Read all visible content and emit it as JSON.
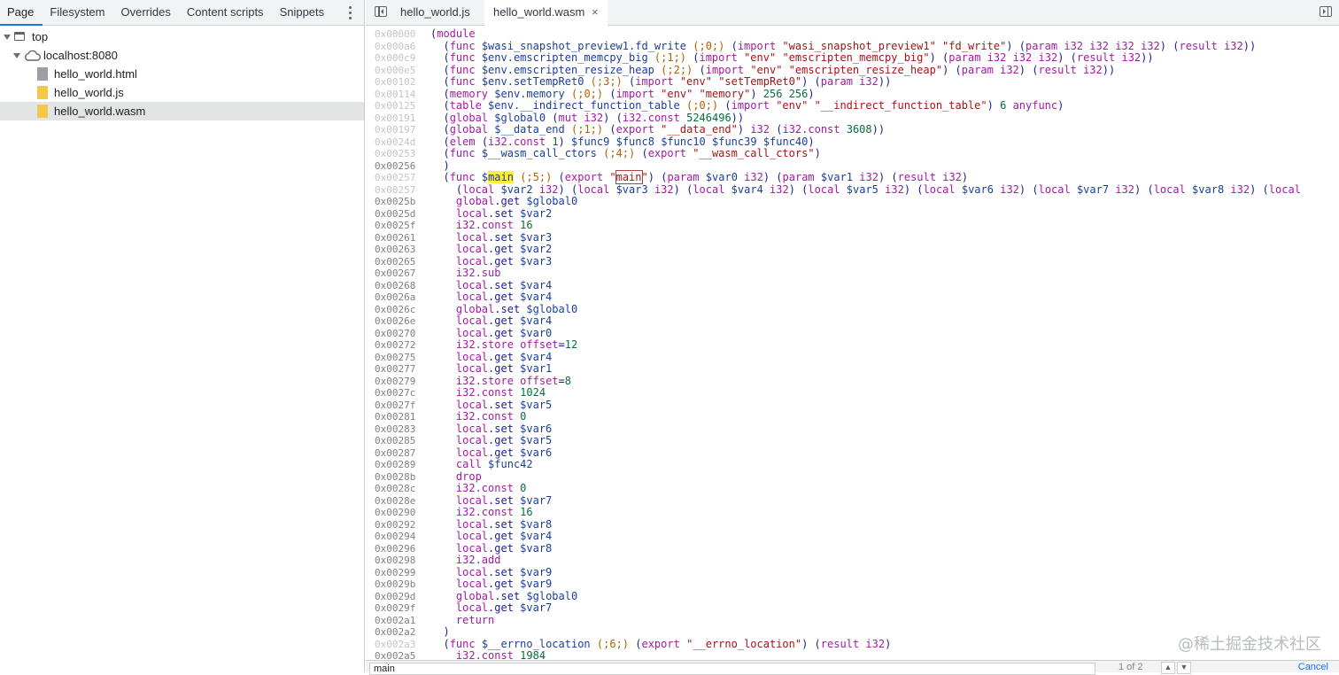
{
  "nav": {
    "tabs": [
      "Page",
      "Filesystem",
      "Overrides",
      "Content scripts",
      "Snippets"
    ],
    "active_tab": "Page",
    "more_icon": "more-vert-icon",
    "tree": [
      {
        "label": "top",
        "icon": "frame-icon"
      },
      {
        "label": "localhost:8080",
        "icon": "cloud-icon"
      },
      {
        "label": "hello_world.html",
        "icon": "file-icon"
      },
      {
        "label": "hello_world.js",
        "icon": "file-icon"
      },
      {
        "label": "hello_world.wasm",
        "icon": "file-icon",
        "selected": true
      }
    ]
  },
  "editor": {
    "tabs": [
      {
        "label": "hello_world.js",
        "active": false
      },
      {
        "label": "hello_world.wasm",
        "active": true,
        "close": "×"
      }
    ],
    "lines": [
      {
        "addr": "0x00000",
        "dim": true,
        "text": "(module"
      },
      {
        "addr": "0x000a6",
        "dim": true,
        "text": "  (func $wasi_snapshot_preview1.fd_write (;0;) (import \"wasi_snapshot_preview1\" \"fd_write\") (param i32 i32 i32 i32) (result i32))"
      },
      {
        "addr": "0x000c9",
        "dim": true,
        "text": "  (func $env.emscripten_memcpy_big (;1;) (import \"env\" \"emscripten_memcpy_big\") (param i32 i32 i32) (result i32))"
      },
      {
        "addr": "0x000e5",
        "dim": true,
        "text": "  (func $env.emscripten_resize_heap (;2;) (import \"env\" \"emscripten_resize_heap\") (param i32) (result i32))"
      },
      {
        "addr": "0x00102",
        "dim": true,
        "text": "  (func $env.setTempRet0 (;3;) (import \"env\" \"setTempRet0\") (param i32))"
      },
      {
        "addr": "0x00114",
        "dim": true,
        "text": "  (memory $env.memory (;0;) (import \"env\" \"memory\") 256 256)"
      },
      {
        "addr": "0x00125",
        "dim": true,
        "text": "  (table $env.__indirect_function_table (;0;) (import \"env\" \"__indirect_function_table\") 6 anyfunc)"
      },
      {
        "addr": "0x00191",
        "dim": true,
        "text": "  (global $global0 (mut i32) (i32.const 5246496))"
      },
      {
        "addr": "0x00197",
        "dim": true,
        "text": "  (global $__data_end (;1;) (export \"__data_end\") i32 (i32.const 3608))"
      },
      {
        "addr": "0x0024d",
        "dim": true,
        "text": "  (elem (i32.const 1) $func9 $func8 $func10 $func39 $func40)"
      },
      {
        "addr": "0x00253",
        "dim": true,
        "text": "  (func $__wasm_call_ctors (;4;) (export \"__wasm_call_ctors\")"
      },
      {
        "addr": "0x00256",
        "dim": false,
        "text": "  )"
      },
      {
        "addr": "0x00257",
        "dim": true,
        "text": "  (func $main (;5;) (export \"main\") (param $var0 i32) (param $var1 i32) (result i32)"
      },
      {
        "addr": "0x00257",
        "dim": true,
        "text": "    (local $var2 i32) (local $var3 i32) (local $var4 i32) (local $var5 i32) (local $var6 i32) (local $var7 i32) (local $var8 i32) (local"
      },
      {
        "addr": "0x0025b",
        "dim": false,
        "text": "    global.get $global0"
      },
      {
        "addr": "0x0025d",
        "dim": false,
        "text": "    local.set $var2"
      },
      {
        "addr": "0x0025f",
        "dim": false,
        "text": "    i32.const 16"
      },
      {
        "addr": "0x00261",
        "dim": false,
        "text": "    local.set $var3"
      },
      {
        "addr": "0x00263",
        "dim": false,
        "text": "    local.get $var2"
      },
      {
        "addr": "0x00265",
        "dim": false,
        "text": "    local.get $var3"
      },
      {
        "addr": "0x00267",
        "dim": false,
        "text": "    i32.sub"
      },
      {
        "addr": "0x00268",
        "dim": false,
        "text": "    local.set $var4"
      },
      {
        "addr": "0x0026a",
        "dim": false,
        "text": "    local.get $var4"
      },
      {
        "addr": "0x0026c",
        "dim": false,
        "text": "    global.set $global0"
      },
      {
        "addr": "0x0026e",
        "dim": false,
        "text": "    local.get $var4"
      },
      {
        "addr": "0x00270",
        "dim": false,
        "text": "    local.get $var0"
      },
      {
        "addr": "0x00272",
        "dim": false,
        "text": "    i32.store offset=12"
      },
      {
        "addr": "0x00275",
        "dim": false,
        "text": "    local.get $var4"
      },
      {
        "addr": "0x00277",
        "dim": false,
        "text": "    local.get $var1"
      },
      {
        "addr": "0x00279",
        "dim": false,
        "text": "    i32.store offset=8"
      },
      {
        "addr": "0x0027c",
        "dim": false,
        "text": "    i32.const 1024"
      },
      {
        "addr": "0x0027f",
        "dim": false,
        "text": "    local.set $var5"
      },
      {
        "addr": "0x00281",
        "dim": false,
        "text": "    i32.const 0"
      },
      {
        "addr": "0x00283",
        "dim": false,
        "text": "    local.set $var6"
      },
      {
        "addr": "0x00285",
        "dim": false,
        "text": "    local.get $var5"
      },
      {
        "addr": "0x00287",
        "dim": false,
        "text": "    local.get $var6"
      },
      {
        "addr": "0x00289",
        "dim": false,
        "text": "    call $func42"
      },
      {
        "addr": "0x0028b",
        "dim": false,
        "text": "    drop"
      },
      {
        "addr": "0x0028c",
        "dim": false,
        "text": "    i32.const 0"
      },
      {
        "addr": "0x0028e",
        "dim": false,
        "text": "    local.set $var7"
      },
      {
        "addr": "0x00290",
        "dim": false,
        "text": "    i32.const 16"
      },
      {
        "addr": "0x00292",
        "dim": false,
        "text": "    local.set $var8"
      },
      {
        "addr": "0x00294",
        "dim": false,
        "text": "    local.get $var4"
      },
      {
        "addr": "0x00296",
        "dim": false,
        "text": "    local.get $var8"
      },
      {
        "addr": "0x00298",
        "dim": false,
        "text": "    i32.add"
      },
      {
        "addr": "0x00299",
        "dim": false,
        "text": "    local.set $var9"
      },
      {
        "addr": "0x0029b",
        "dim": false,
        "text": "    local.get $var9"
      },
      {
        "addr": "0x0029d",
        "dim": false,
        "text": "    global.set $global0"
      },
      {
        "addr": "0x0029f",
        "dim": false,
        "text": "    local.get $var7"
      },
      {
        "addr": "0x002a1",
        "dim": false,
        "text": "    return"
      },
      {
        "addr": "0x002a2",
        "dim": false,
        "text": "  )"
      },
      {
        "addr": "0x002a3",
        "dim": true,
        "text": "  (func $__errno_location (;6;) (export \"__errno_location\") (result i32)"
      },
      {
        "addr": "0x002a5",
        "dim": false,
        "text": "    i32.const 1984"
      }
    ],
    "search_highlight": "main"
  },
  "search": {
    "value": "main",
    "count": "1 of 2",
    "prev_icon": "chevron-up-icon",
    "next_icon": "chevron-down-icon",
    "cancel_label": "Cancel"
  },
  "watermark": "@稀土掘金技术社区"
}
